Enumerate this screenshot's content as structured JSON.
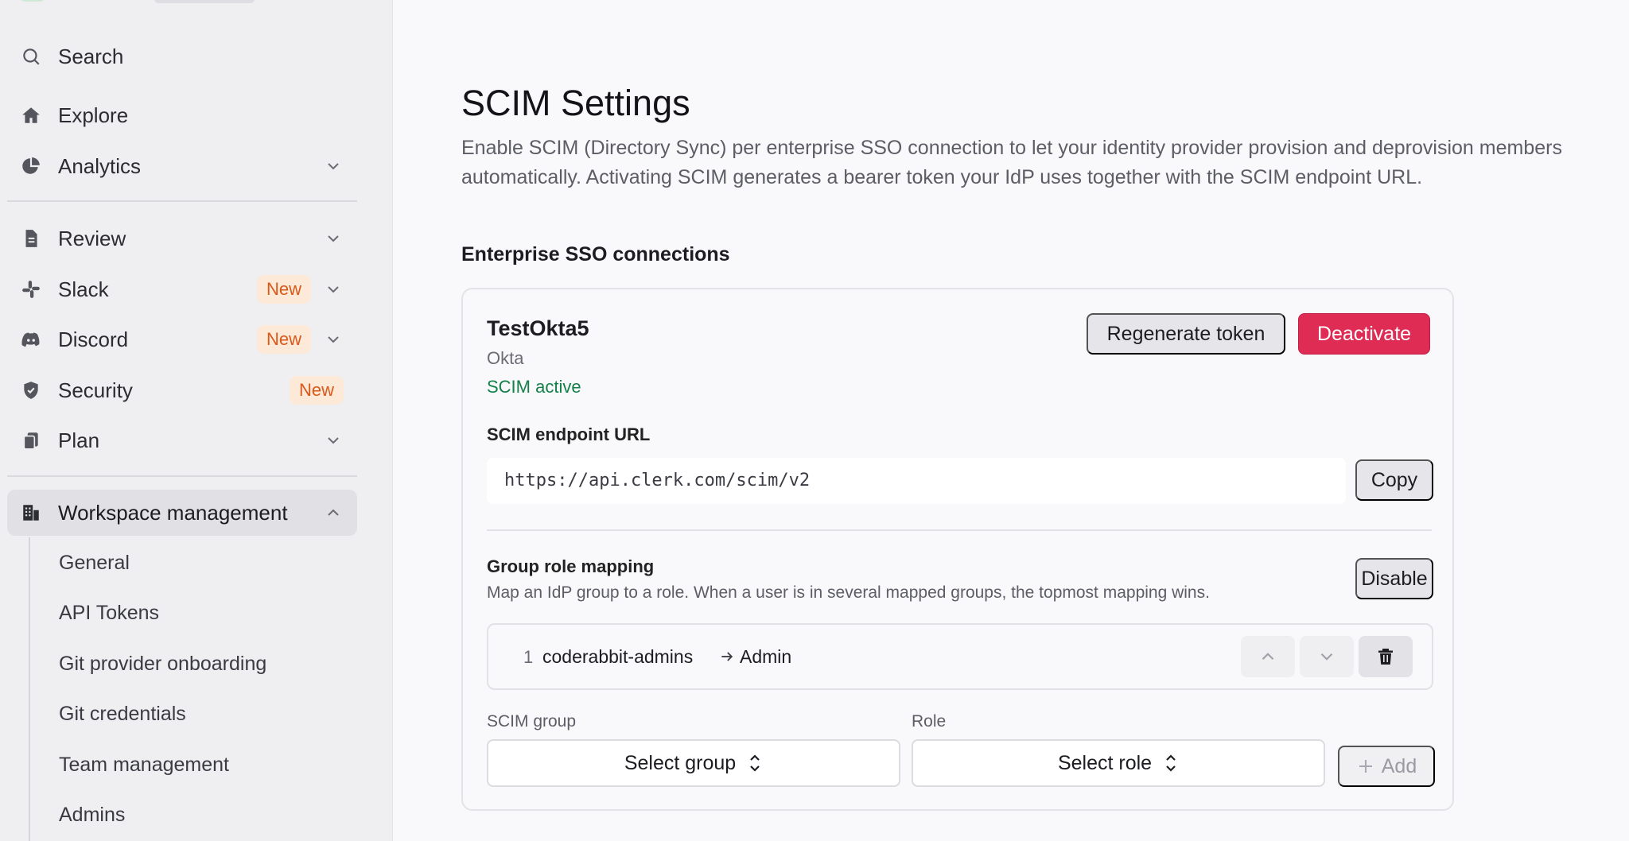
{
  "sidebar": {
    "search_label": "Search",
    "items": [
      {
        "label": "Explore"
      },
      {
        "label": "Analytics"
      },
      {
        "label": "Review"
      },
      {
        "label": "Slack",
        "badge": "New"
      },
      {
        "label": "Discord",
        "badge": "New"
      },
      {
        "label": "Security",
        "badge": "New"
      },
      {
        "label": "Plan"
      },
      {
        "label": "Workspace management"
      }
    ],
    "sub_items": [
      {
        "label": "General"
      },
      {
        "label": "API Tokens"
      },
      {
        "label": "Git provider onboarding"
      },
      {
        "label": "Git credentials"
      },
      {
        "label": "Team management"
      },
      {
        "label": "Admins"
      }
    ]
  },
  "page": {
    "title": "SCIM Settings",
    "description": "Enable SCIM (Directory Sync) per enterprise SSO connection to let your identity provider provision and deprovision members automatically. Activating SCIM generates a bearer token your IdP uses together with the SCIM endpoint URL.",
    "section_title": "Enterprise SSO connections"
  },
  "connection": {
    "name": "TestOkta5",
    "provider": "Okta",
    "status": "SCIM active",
    "regenerate_label": "Regenerate token",
    "deactivate_label": "Deactivate",
    "endpoint_label": "SCIM endpoint URL",
    "endpoint_url": "https://api.clerk.com/scim/v2",
    "copy_label": "Copy",
    "group_role_mapping": {
      "title": "Group role mapping",
      "description": "Map an IdP group to a role. When a user is in several mapped groups, the topmost mapping wins.",
      "disable_label": "Disable",
      "mappings": [
        {
          "index": "1",
          "group": "coderabbit-admins",
          "role": "Admin"
        }
      ],
      "scim_group_label": "SCIM group",
      "role_label": "Role",
      "group_select_value": "Select group",
      "role_select_value": "Select role",
      "add_label": "Add"
    }
  },
  "colors": {
    "sidebar_bg": "#efeff1",
    "main_bg": "#f9f9fb",
    "badge_bg": "#fde9d7",
    "badge_text": "#d8591b",
    "danger": "#df2c55",
    "success": "#148049"
  }
}
